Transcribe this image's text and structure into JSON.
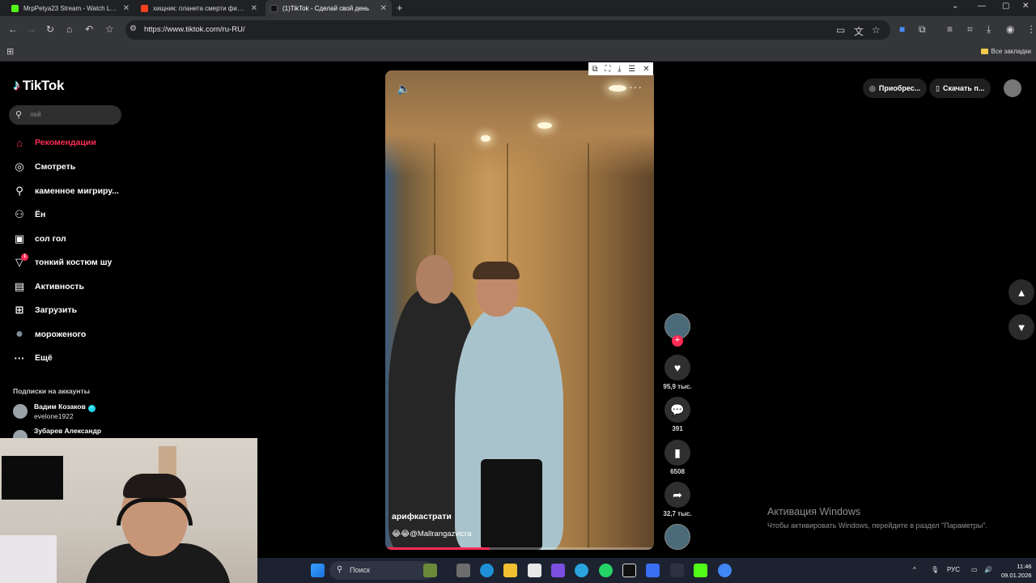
{
  "browser": {
    "tabs": [
      {
        "label": "MrpPetya23 Stream - Watch Live",
        "favicon_color": "#53fc18"
      },
      {
        "label": "хищник: планета смерти фильм",
        "favicon_color": "#fc3f1d"
      },
      {
        "label": "(1)TikTok - Сделай свой день",
        "favicon_color": "#111111"
      }
    ],
    "new_tab": "+",
    "url": "https://www.tiktok.com/ru-RU/",
    "all_bookmarks": "Все закладки"
  },
  "sidebar": {
    "logo": "TikTok",
    "search_placeholder": "лей",
    "nav": [
      {
        "label": "Рекомендации",
        "icon": "home-icon",
        "glyph": "⌂"
      },
      {
        "label": "Смотреть",
        "icon": "compass-icon",
        "glyph": "◎"
      },
      {
        "label": "каменное мигриру...",
        "icon": "user-plus-icon",
        "glyph": "⚲"
      },
      {
        "label": "Ён",
        "icon": "friends-icon",
        "glyph": "⚇"
      },
      {
        "label": "сол гол",
        "icon": "live-icon",
        "glyph": "▣"
      },
      {
        "label": "тонкий костюм шу",
        "icon": "inbox-icon",
        "glyph": "▽",
        "badge": "1"
      },
      {
        "label": "Активность",
        "icon": "activity-icon",
        "glyph": "▤"
      },
      {
        "label": "Загрузить",
        "icon": "upload-icon",
        "glyph": "⊞"
      },
      {
        "label": "мороженого",
        "icon": "profile-avatar-icon",
        "glyph": "●"
      },
      {
        "label": "Ещё",
        "icon": "more-icon",
        "glyph": "···"
      }
    ],
    "subs_heading": "Подписки на аккаунты",
    "subs": [
      {
        "name": "Вадим Козаков",
        "handle": "evelone1922",
        "verified": true
      },
      {
        "name": "Зубарев Александр",
        "handle": ""
      }
    ]
  },
  "video": {
    "author": "арифкастрати",
    "description": "😂😂@Mallrangazvicra",
    "progress": 0.39
  },
  "actions": {
    "likes": "95,9 тыс.",
    "comments": "391",
    "saves": "6508",
    "shares": "32,7 тыс."
  },
  "top_right": {
    "buy_label": "Приобрес...",
    "download_label": "Скачать п..."
  },
  "windows_activation": {
    "title": "Активация Windows",
    "subtitle": "Чтобы активировать Windows, перейдите в раздел \"Параметры\"."
  },
  "taskbar": {
    "search_label": "Поиск",
    "lang": "РУС",
    "time": "11:46",
    "date": "09.01.2026"
  }
}
